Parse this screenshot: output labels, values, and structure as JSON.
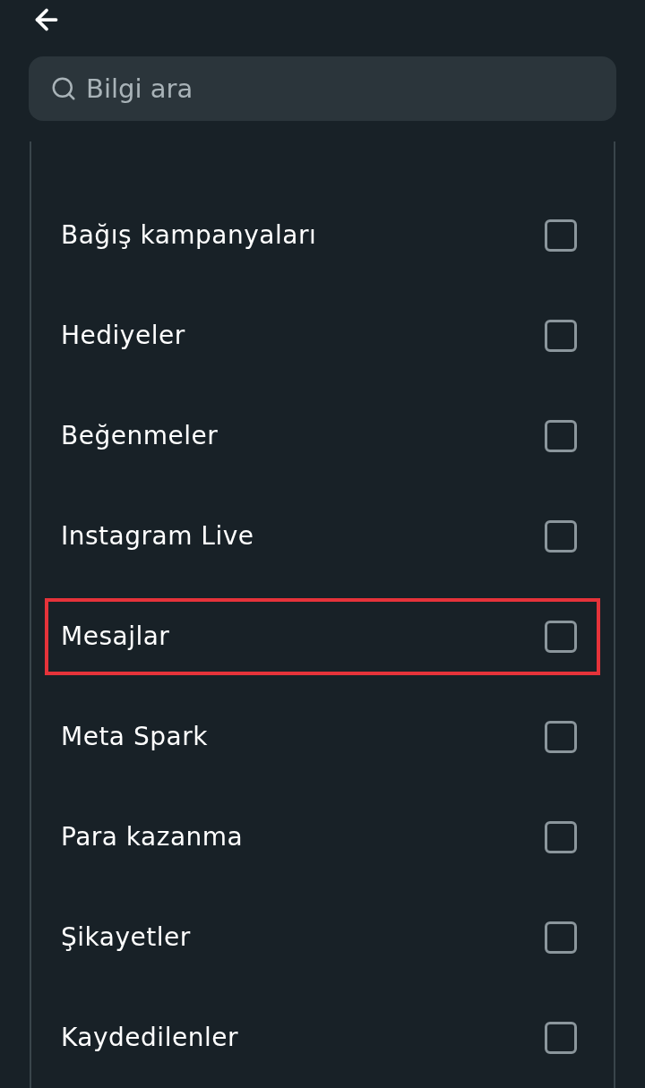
{
  "search": {
    "placeholder": "Bilgi ara"
  },
  "items": [
    {
      "label": "Bağış kampanyaları",
      "checked": false,
      "highlighted": false
    },
    {
      "label": "Hediyeler",
      "checked": false,
      "highlighted": false
    },
    {
      "label": "Beğenmeler",
      "checked": false,
      "highlighted": false
    },
    {
      "label": "Instagram Live",
      "checked": false,
      "highlighted": false
    },
    {
      "label": "Mesajlar",
      "checked": false,
      "highlighted": true
    },
    {
      "label": "Meta Spark",
      "checked": false,
      "highlighted": false
    },
    {
      "label": "Para kazanma",
      "checked": false,
      "highlighted": false
    },
    {
      "label": "Şikayetler",
      "checked": false,
      "highlighted": false
    },
    {
      "label": "Kaydedilenler",
      "checked": false,
      "highlighted": false
    }
  ]
}
